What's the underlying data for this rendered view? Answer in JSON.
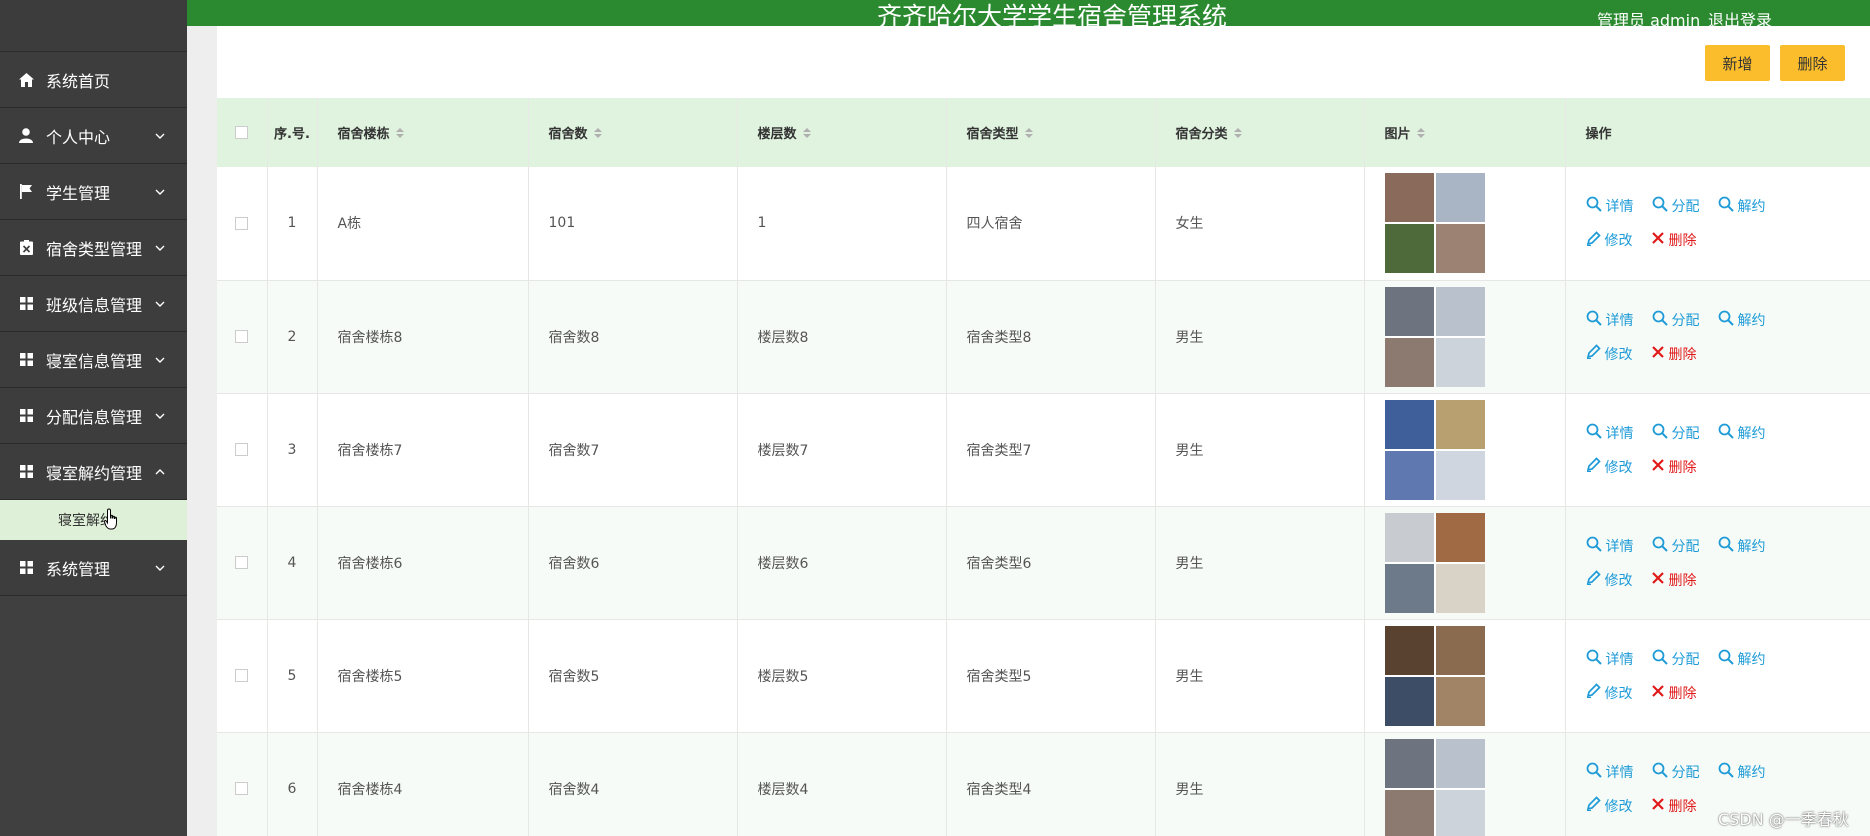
{
  "header": {
    "title": "齐齐哈尔大学学生宿舍管理系统",
    "user": "管理员 admin",
    "logout": "退出登录"
  },
  "sidebar": {
    "items": [
      {
        "label": "系统首页",
        "icon": "home-icon"
      },
      {
        "label": "个人中心",
        "icon": "user-icon"
      },
      {
        "label": "学生管理",
        "icon": "flag-icon"
      },
      {
        "label": "宿舍类型管理",
        "icon": "clipboard-icon"
      },
      {
        "label": "班级信息管理",
        "icon": "grid-icon"
      },
      {
        "label": "寝室信息管理",
        "icon": "grid-icon"
      },
      {
        "label": "分配信息管理",
        "icon": "grid-icon"
      },
      {
        "label": "寝室解约管理",
        "icon": "grid-icon"
      },
      {
        "label": "系统管理",
        "icon": "grid-icon"
      }
    ],
    "sub_item": "寝室解约"
  },
  "toolbar": {
    "add_label": "新增",
    "delete_label": "删除"
  },
  "table": {
    "columns": [
      "序.号.",
      "宿舍楼栋",
      "宿舍数",
      "楼层数",
      "宿舍类型",
      "宿舍分类",
      "图片",
      "操作"
    ],
    "rows": [
      {
        "idx": "1",
        "building": "A栋",
        "rooms": "101",
        "floors": "1",
        "type": "四人宿舍",
        "category": "女生"
      },
      {
        "idx": "2",
        "building": "宿舍楼栋8",
        "rooms": "宿舍数8",
        "floors": "楼层数8",
        "type": "宿舍类型8",
        "category": "男生"
      },
      {
        "idx": "3",
        "building": "宿舍楼栋7",
        "rooms": "宿舍数7",
        "floors": "楼层数7",
        "type": "宿舍类型7",
        "category": "男生"
      },
      {
        "idx": "4",
        "building": "宿舍楼栋6",
        "rooms": "宿舍数6",
        "floors": "楼层数6",
        "type": "宿舍类型6",
        "category": "男生"
      },
      {
        "idx": "5",
        "building": "宿舍楼栋5",
        "rooms": "宿舍数5",
        "floors": "楼层数5",
        "type": "宿舍类型5",
        "category": "男生"
      },
      {
        "idx": "6",
        "building": "宿舍楼栋4",
        "rooms": "宿舍数4",
        "floors": "楼层数4",
        "type": "宿舍类型4",
        "category": "男生"
      }
    ],
    "ops": {
      "detail": "详情",
      "assign": "分配",
      "terminate": "解约",
      "edit": "修改",
      "delete": "删除"
    }
  },
  "watermark": "CSDN @一季春秋",
  "colors": {
    "header_green": "#2b8a2f",
    "sidebar_bg": "#404040",
    "button_yellow": "#fbbd2b",
    "table_header": "#dff3df",
    "link_blue": "#1e9bd7",
    "delete_red": "#e01a1a"
  }
}
